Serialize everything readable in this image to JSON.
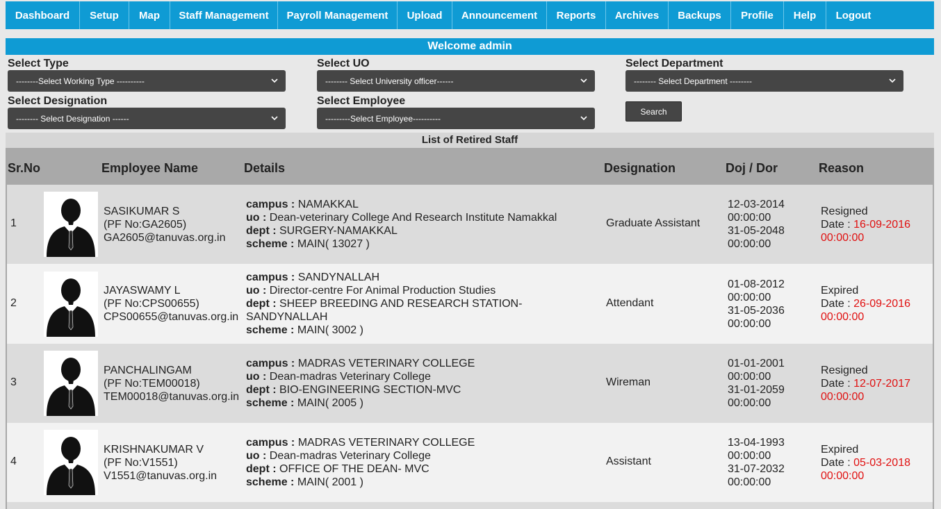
{
  "nav": [
    {
      "label": "Dashboard"
    },
    {
      "label": "Setup"
    },
    {
      "label": "Map"
    },
    {
      "label": "Staff Management"
    },
    {
      "label": "Payroll Management"
    },
    {
      "label": "Upload"
    },
    {
      "label": "Announcement"
    },
    {
      "label": "Reports"
    },
    {
      "label": "Archives"
    },
    {
      "label": "Backups"
    },
    {
      "label": "Profile"
    },
    {
      "label": "Help"
    },
    {
      "label": "Logout"
    }
  ],
  "welcome": "Welcome admin",
  "filters": {
    "type": {
      "label": "Select Type",
      "value": "--------Select Working Type ----------"
    },
    "uo": {
      "label": "Select UO",
      "value": "-------- Select University officer------"
    },
    "department": {
      "label": "Select Department",
      "value": "-------- Select Department --------"
    },
    "designation": {
      "label": "Select Designation",
      "value": "-------- Select Designation ------"
    },
    "employee": {
      "label": "Select Employee",
      "value": "---------Select Employee----------"
    },
    "search_label": "Search"
  },
  "list_title": "List of Retired Staff",
  "columns": {
    "srno": "Sr.No",
    "name": "Employee Name",
    "details": "Details",
    "designation": "Designation",
    "doj": "Doj / Dor",
    "reason": "Reason"
  },
  "labels": {
    "campus": "campus :",
    "uo": "uo :",
    "dept": "dept :",
    "scheme": "scheme :",
    "date": "Date :"
  },
  "rows": [
    {
      "sr": "1",
      "name": "SASIKUMAR S",
      "pf": "(PF No:GA2605)",
      "email": "GA2605@tanuvas.org.in",
      "campus": "NAMAKKAL",
      "uo": "Dean-veterinary College And Research Institute Namakkal",
      "dept": "SURGERY-NAMAKKAL",
      "dept2": "",
      "scheme": "MAIN( 13027 )",
      "designation": "Graduate Assistant",
      "doj": [
        "12-03-2014",
        "00:00:00",
        "31-05-2048",
        "00:00:00"
      ],
      "reason": "Resigned",
      "date": "16-09-2016",
      "time": "00:00:00"
    },
    {
      "sr": "2",
      "name": "JAYASWAMY L",
      "pf": "(PF No:CPS00655)",
      "email": "CPS00655@tanuvas.org.in",
      "campus": "SANDYNALLAH",
      "uo": "Director-centre For Animal Production Studies",
      "dept": "SHEEP BREEDING AND RESEARCH STATION-",
      "dept2": "SANDYNALLAH",
      "scheme": "MAIN( 3002 )",
      "designation": "Attendant",
      "doj": [
        "01-08-2012",
        "00:00:00",
        "31-05-2036",
        "00:00:00"
      ],
      "reason": "Expired",
      "date": "26-09-2016",
      "time": "00:00:00"
    },
    {
      "sr": "3",
      "name": "PANCHALINGAM",
      "pf": "(PF No:TEM00018)",
      "email": "TEM00018@tanuvas.org.in",
      "campus": "MADRAS VETERINARY COLLEGE",
      "uo": "Dean-madras Veterinary College",
      "dept": "BIO-ENGINEERING SECTION-MVC",
      "dept2": "",
      "scheme": "MAIN( 2005 )",
      "designation": "Wireman",
      "doj": [
        "01-01-2001",
        "00:00:00",
        "31-01-2059",
        "00:00:00"
      ],
      "reason": "Resigned",
      "date": "12-07-2017",
      "time": "00:00:00"
    },
    {
      "sr": "4",
      "name": "KRISHNAKUMAR V",
      "pf": "(PF No:V1551)",
      "email": "V1551@tanuvas.org.in",
      "campus": "MADRAS VETERINARY COLLEGE",
      "uo": "Dean-madras Veterinary College",
      "dept": "OFFICE OF THE DEAN- MVC",
      "dept2": "",
      "scheme": "MAIN( 2001 )",
      "designation": "Assistant",
      "doj": [
        "13-04-1993",
        "00:00:00",
        "31-07-2032",
        "00:00:00"
      ],
      "reason": "Expired",
      "date": "05-03-2018",
      "time": "00:00:00"
    }
  ]
}
